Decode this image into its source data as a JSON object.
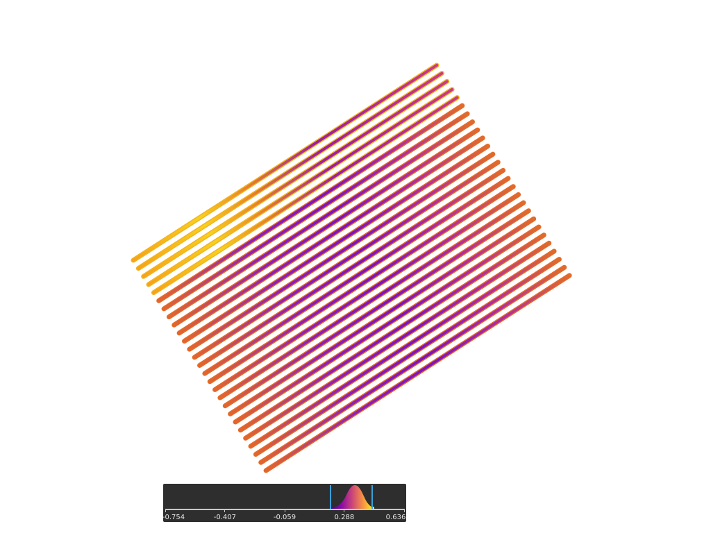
{
  "visualization": {
    "colormap": "plasma",
    "strip_count": 27
  },
  "colorbar": {
    "ticks": [
      {
        "value": -0.754,
        "label": "-0.754"
      },
      {
        "value": -0.407,
        "label": "-0.407"
      },
      {
        "value": -0.059,
        "label": "-0.059"
      },
      {
        "value": 0.288,
        "label": "0.288"
      },
      {
        "value": 0.636,
        "label": "0.636"
      }
    ],
    "range": [
      -0.754,
      0.636
    ],
    "selected_range": [
      0.2,
      0.42
    ],
    "colors": {
      "background": "#2e2e2e",
      "axis": "#c9c9c9",
      "handle": "#3ba0d8"
    }
  }
}
